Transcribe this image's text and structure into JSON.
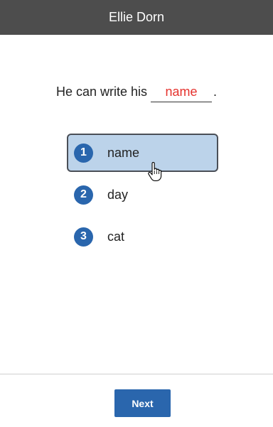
{
  "header": {
    "title": "Ellie Dorn"
  },
  "question": {
    "prefix": "He can write his",
    "answer": "name",
    "suffix": "."
  },
  "options": [
    {
      "number": "1",
      "word": "name",
      "selected": true
    },
    {
      "number": "2",
      "word": "day",
      "selected": false
    },
    {
      "number": "3",
      "word": "cat",
      "selected": false
    }
  ],
  "footer": {
    "next_label": "Next"
  },
  "colors": {
    "header_bg": "#4d4d4d",
    "accent": "#2a66ad",
    "selected_bg": "#bcd3ea",
    "answer_text": "#e5322d"
  },
  "icons": {
    "cursor": "hand-pointer-icon"
  }
}
